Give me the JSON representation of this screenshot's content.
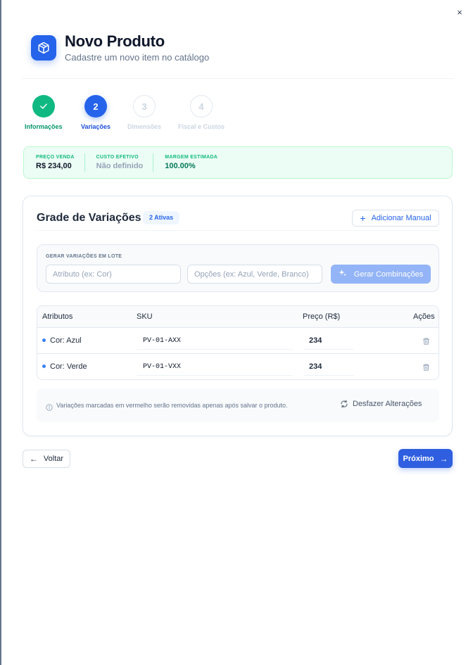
{
  "dialog": {
    "close_label": "×",
    "title": "Novo Produto",
    "subtitle": "Cadastre um novo item no catálogo"
  },
  "stepper": {
    "steps": [
      {
        "number": "1",
        "label": "Informações",
        "state": "done"
      },
      {
        "number": "2",
        "label": "Variações",
        "state": "active"
      },
      {
        "number": "3",
        "label": "Dimensões",
        "state": "pending"
      },
      {
        "number": "4",
        "label": "Fiscal e Custos",
        "state": "pending"
      }
    ]
  },
  "summary": {
    "items": [
      {
        "label": "PREÇO VENDA",
        "value": "R$ 234,00",
        "color": "#0f172a"
      },
      {
        "label": "CUSTO EFETIVO",
        "value": "Não definido",
        "color": "#94a3b8"
      },
      {
        "label": "MARGEM ESTIMADA",
        "value": "100.00%",
        "color": "#047857"
      }
    ]
  },
  "grid": {
    "title": "Grade de Variações",
    "badge": "2 Ativas",
    "add_button": "Adicionar Manual",
    "batch": {
      "label": "GERAR VARIAÇÕES EM LOTE",
      "attribute_placeholder": "Atributo (ex: Cor)",
      "options_placeholder": "Opções (ex: Azul, Verde, Branco)",
      "attribute_value": "",
      "options_value": "",
      "generate_button": "Gerar Combinações"
    },
    "table": {
      "headers": [
        "Atributos",
        "SKU",
        "Preço (R$)",
        "Ações"
      ],
      "rows": [
        {
          "attribute": "Cor: Azul",
          "sku": "PV-01-AXX",
          "price": "234"
        },
        {
          "attribute": "Cor: Verde",
          "sku": "PV-01-VXX",
          "price": "234"
        }
      ]
    },
    "info_text": "Variações marcadas em vermelho serão removidas apenas após salvar o produto.",
    "undo_button": "Desfazer Alterações"
  },
  "footer": {
    "back_button": "Voltar",
    "next_button": "Próximo"
  },
  "colors": {
    "accent": "#2563eb",
    "success": "#10b981"
  }
}
